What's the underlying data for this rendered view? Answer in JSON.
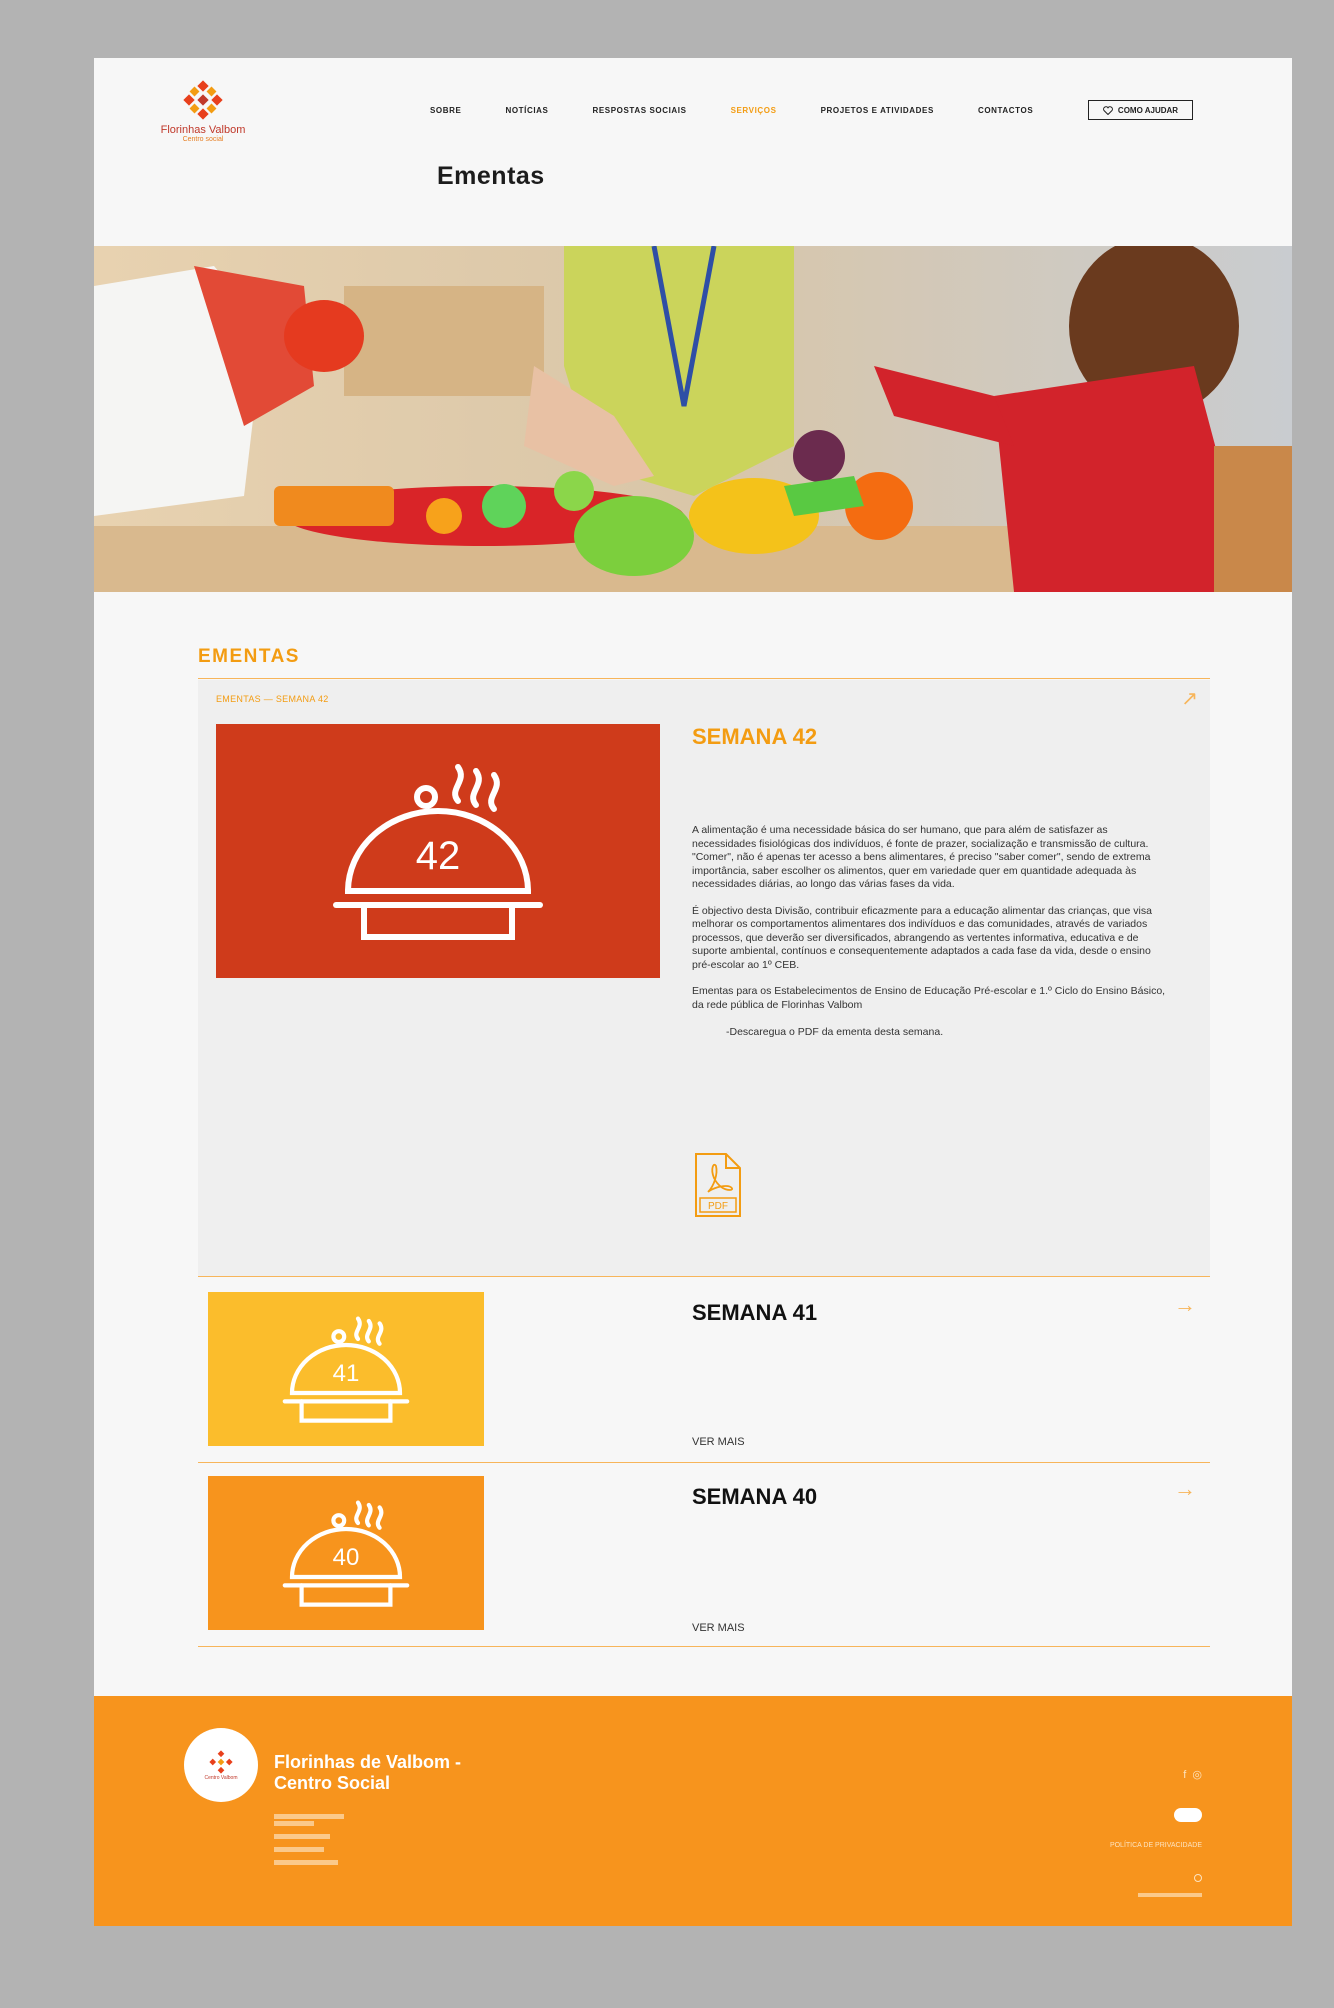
{
  "brand": {
    "name_line1": "Florinhas Valbom",
    "name_line2": "Centro social"
  },
  "nav": {
    "items": [
      {
        "label": "SOBRE",
        "active": false
      },
      {
        "label": "NOTÍCIAS",
        "active": false
      },
      {
        "label": "RESPOSTAS SOCIAIS",
        "active": false
      },
      {
        "label": "SERVIÇOS",
        "active": true
      },
      {
        "label": "PROJETOS E ATIVIDADES",
        "active": false
      },
      {
        "label": "CONTACTOS",
        "active": false
      }
    ],
    "help_button": "COMO AJUDAR"
  },
  "page": {
    "title": "Ementas"
  },
  "section": {
    "title": "EMENTAS"
  },
  "featured": {
    "breadcrumb": "EMENTAS — SEMANA 42",
    "heading": "SEMANA 42",
    "badge_number": "42",
    "paragraphs": [
      "A alimentação é uma necessidade básica do ser humano, que para além de satisfazer as necessidades fisiológicas dos indivíduos, é fonte de prazer, socialização e transmissão de cultura. \"Comer\", não é apenas ter acesso a bens alimentares, é preciso \"saber comer\", sendo de extrema importância, saber escolher os alimentos, quer em variedade quer em quantidade adequada às necessidades diárias, ao longo das várias fases da vida.",
      "É objectivo desta Divisão, contribuir eficazmente para a educação alimentar das crianças, que visa melhorar os comportamentos alimentares dos indivíduos e das comunidades, através de variados processos, que deverão ser diversificados, abrangendo as vertentes informativa, educativa e de suporte ambiental, contínuos e consequentemente adaptados a cada fase da vida, desde o ensino pré-escolar ao 1º CEB.",
      "Ementas para os Estabelecimentos de Ensino de Educação Pré-escolar e 1.º Ciclo do Ensino Básico, da rede pública de Florinhas Valbom"
    ],
    "download_text": "-Descaregua o PDF da ementa desta semana.",
    "pdf_label": "PDF"
  },
  "weeks": [
    {
      "title": "SEMANA 41",
      "number": "41",
      "more": "VER MAIS",
      "color": "#fbbd2c"
    },
    {
      "title": "SEMANA 40",
      "number": "40",
      "more": "VER MAIS",
      "color": "#f7941d"
    }
  ],
  "footer": {
    "name_line1": "Florinhas de Valbom -",
    "name_line2": "Centro Social",
    "logo_text": "Centro Valbom",
    "policy": "POLÍTICA DE PRIVACIDADE"
  },
  "colors": {
    "accent": "#f39c12",
    "featured_red": "#cf3b1b",
    "footer_orange": "#f7941d"
  }
}
